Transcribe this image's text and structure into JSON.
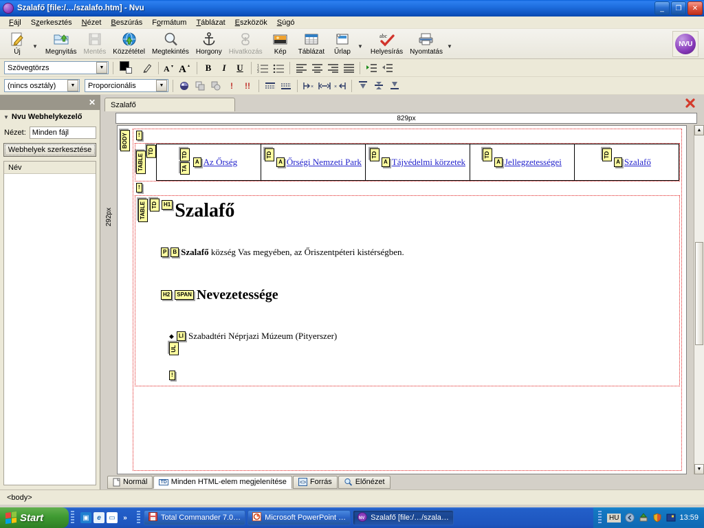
{
  "window": {
    "title": "Szalafő [file:/…/szalafo.htm] - Nvu",
    "logo_icon": "nvu-logo-icon",
    "minimize_label": "_",
    "restore_label": "❐",
    "close_label": "✕"
  },
  "menubar": {
    "items": [
      {
        "label": "Fájl",
        "accel": "F"
      },
      {
        "label": "Szerkesztés",
        "accel": "z"
      },
      {
        "label": "Nézet",
        "accel": "N"
      },
      {
        "label": "Beszúrás",
        "accel": "B"
      },
      {
        "label": "Formátum",
        "accel": "o"
      },
      {
        "label": "Táblázat",
        "accel": "T"
      },
      {
        "label": "Eszközök",
        "accel": "E"
      },
      {
        "label": "Súgó",
        "accel": "S"
      }
    ]
  },
  "toolbar": {
    "buttons": [
      {
        "label": "Új",
        "icon": "new-document-icon",
        "disabled": false,
        "dropdown": true
      },
      {
        "label": "Megnyitás",
        "icon": "open-folder-icon",
        "disabled": false,
        "dropdown": false
      },
      {
        "label": "Mentés",
        "icon": "floppy-save-icon",
        "disabled": true,
        "dropdown": false
      },
      {
        "label": "Közzététel",
        "icon": "globe-publish-icon",
        "disabled": false,
        "dropdown": false
      },
      {
        "label": "Megtekintés",
        "icon": "magnifier-browse-icon",
        "disabled": false,
        "dropdown": false
      },
      {
        "label": "Horgony",
        "icon": "anchor-icon",
        "disabled": false,
        "dropdown": false
      },
      {
        "label": "Hivatkozás",
        "icon": "chain-link-icon",
        "disabled": true,
        "dropdown": false
      },
      {
        "label": "Kép",
        "icon": "picture-icon",
        "disabled": false,
        "dropdown": false
      },
      {
        "label": "Táblázat",
        "icon": "table-grid-icon",
        "disabled": false,
        "dropdown": false
      },
      {
        "label": "Űrlap",
        "icon": "form-icon",
        "disabled": false,
        "dropdown": true
      },
      {
        "label": "Helyesírás",
        "icon": "spellcheck-abc-icon",
        "disabled": false,
        "dropdown": false
      },
      {
        "label": "Nyomtatás",
        "icon": "printer-icon",
        "disabled": false,
        "dropdown": true
      }
    ],
    "nvu_button_label": "NVU"
  },
  "format_bar_1": {
    "paragraph_style_value": "Szövegtörzs",
    "foreground_color": "#000000",
    "background_color": "#ffffff",
    "icons": [
      {
        "name": "highlight-pen-icon",
        "glyph": "✐"
      },
      {
        "name": "decrease-font-size-icon",
        "glyph": "A˅"
      },
      {
        "name": "increase-font-size-icon",
        "glyph": "A˄"
      },
      {
        "name": "bold-icon",
        "glyph": "B"
      },
      {
        "name": "italic-icon",
        "glyph": "I"
      },
      {
        "name": "underline-icon",
        "glyph": "U"
      },
      {
        "name": "numbered-list-icon",
        "glyph": "≔"
      },
      {
        "name": "bulleted-list-icon",
        "glyph": "☰"
      },
      {
        "name": "align-left-icon",
        "glyph": "≡"
      },
      {
        "name": "align-center-icon",
        "glyph": "≡"
      },
      {
        "name": "align-right-icon",
        "glyph": "≡"
      },
      {
        "name": "align-justify-icon",
        "glyph": "≣"
      },
      {
        "name": "indent-more-icon",
        "glyph": "⇥"
      },
      {
        "name": "indent-less-icon",
        "glyph": "⇤"
      }
    ]
  },
  "format_bar_2": {
    "class_value": "(nincs osztály)",
    "font_value": "Proporcionális",
    "icons": [
      {
        "name": "css-editor-icon",
        "glyph": "◕"
      },
      {
        "name": "layer-behind-icon",
        "glyph": "❑"
      },
      {
        "name": "layer-front-icon",
        "glyph": "❑"
      },
      {
        "name": "priority-low-icon",
        "glyph": "!"
      },
      {
        "name": "priority-high-icon",
        "glyph": "!!"
      },
      {
        "name": "row-top-icon",
        "glyph": "≖"
      },
      {
        "name": "row-bottom-icon",
        "glyph": "≖"
      },
      {
        "name": "cell-shrink-left-icon",
        "glyph": "≫"
      },
      {
        "name": "cell-split-icon",
        "glyph": "≭"
      },
      {
        "name": "cell-shrink-right-icon",
        "glyph": "≪"
      },
      {
        "name": "table-top-align-icon",
        "glyph": "▽"
      },
      {
        "name": "table-middle-align-icon",
        "glyph": "▽"
      },
      {
        "name": "table-bottom-align-icon",
        "glyph": "▽"
      }
    ]
  },
  "sidebar": {
    "close_label": "✕",
    "panel_title": "Nvu Webhelykezelő",
    "collapse_icon": "triangle-down-icon",
    "view_label": "Nézet:",
    "view_value": "Minden fájl",
    "edit_sites_button": "Webhelyek szerkesztése",
    "list_header": "Név",
    "list_items": []
  },
  "editor": {
    "document_tab": "Szalafő",
    "tab_close_icon": "close-document-icon",
    "horizontal_ruler_value": "829px",
    "vertical_ruler_value": "292px"
  },
  "page": {
    "body_tag": "BODY",
    "nav_table": {
      "table_tag": "TABLE",
      "tr_tag": "TD",
      "cells": [
        {
          "td_tag": "TD",
          "extra_tag": "TA",
          "a_tag": "A",
          "link": "Az Őrség"
        },
        {
          "td_tag": "TD",
          "a_tag": "A",
          "link": "Őrségi Nemzeti Park"
        },
        {
          "td_tag": "TD",
          "a_tag": "A",
          "link": "Tájvédelmi körzetek"
        },
        {
          "td_tag": "TD",
          "a_tag": "A",
          "link": "Jellegzetességei"
        },
        {
          "td_tag": "TD",
          "a_tag": "A",
          "link": "Szalafő"
        }
      ]
    },
    "content_table": {
      "table_tag": "TABLE",
      "td_tag": "TD",
      "h1_tag": "H1",
      "heading": "Szalafő",
      "p_tag": "P",
      "b_tag": "B",
      "para_bold": "Szalafő",
      "para_rest": " község Vas megyében, az Őriszentpéteri kistérségben.",
      "h2_tag": "H2",
      "span_tag": "SPAN",
      "subheading": "Nevezetessége",
      "ul_tag": "UL",
      "li_tag": "LI",
      "bullet_glyph": "◆",
      "list_item": "Szabadtéri Néprjazi Múzeum (Pityerszer)",
      "excl_tag": "!"
    }
  },
  "view_tabs": [
    {
      "label": "Normál",
      "icon": "page-icon",
      "active": false
    },
    {
      "label": "Minden HTML-elem megjelenítése",
      "icon": "td-tag-icon",
      "active": true
    },
    {
      "label": "Forrás",
      "icon": "source-code-icon",
      "active": false
    },
    {
      "label": "Előnézet",
      "icon": "preview-magnifier-icon",
      "active": false
    }
  ],
  "statusbar": {
    "path": "<body>"
  },
  "taskbar": {
    "start_label": "Start",
    "quicklaunch": [
      {
        "name": "show-desktop-icon",
        "glyph": "🗗"
      },
      {
        "name": "internet-explorer-icon",
        "glyph": "e"
      },
      {
        "name": "window-icon",
        "glyph": "▭"
      },
      {
        "name": "more-chevron-icon",
        "glyph": "»"
      }
    ],
    "tasks": [
      {
        "label": "Total Commander 7.0…",
        "icon": "floppy-icon",
        "active": false
      },
      {
        "label": "Microsoft PowerPoint …",
        "icon": "powerpoint-icon",
        "active": false
      },
      {
        "label": "Szalafő [file:/…/szala…",
        "icon": "nvu-logo-icon",
        "active": true
      }
    ],
    "tray": {
      "language": "HU",
      "icons": [
        {
          "name": "tray-back-arrow-icon",
          "glyph": "◀"
        },
        {
          "name": "tray-update-icon",
          "glyph": "⬆"
        },
        {
          "name": "tray-shield-icon",
          "glyph": "🛡"
        },
        {
          "name": "tray-network-icon",
          "glyph": "▣"
        }
      ],
      "clock": "13:59"
    }
  }
}
